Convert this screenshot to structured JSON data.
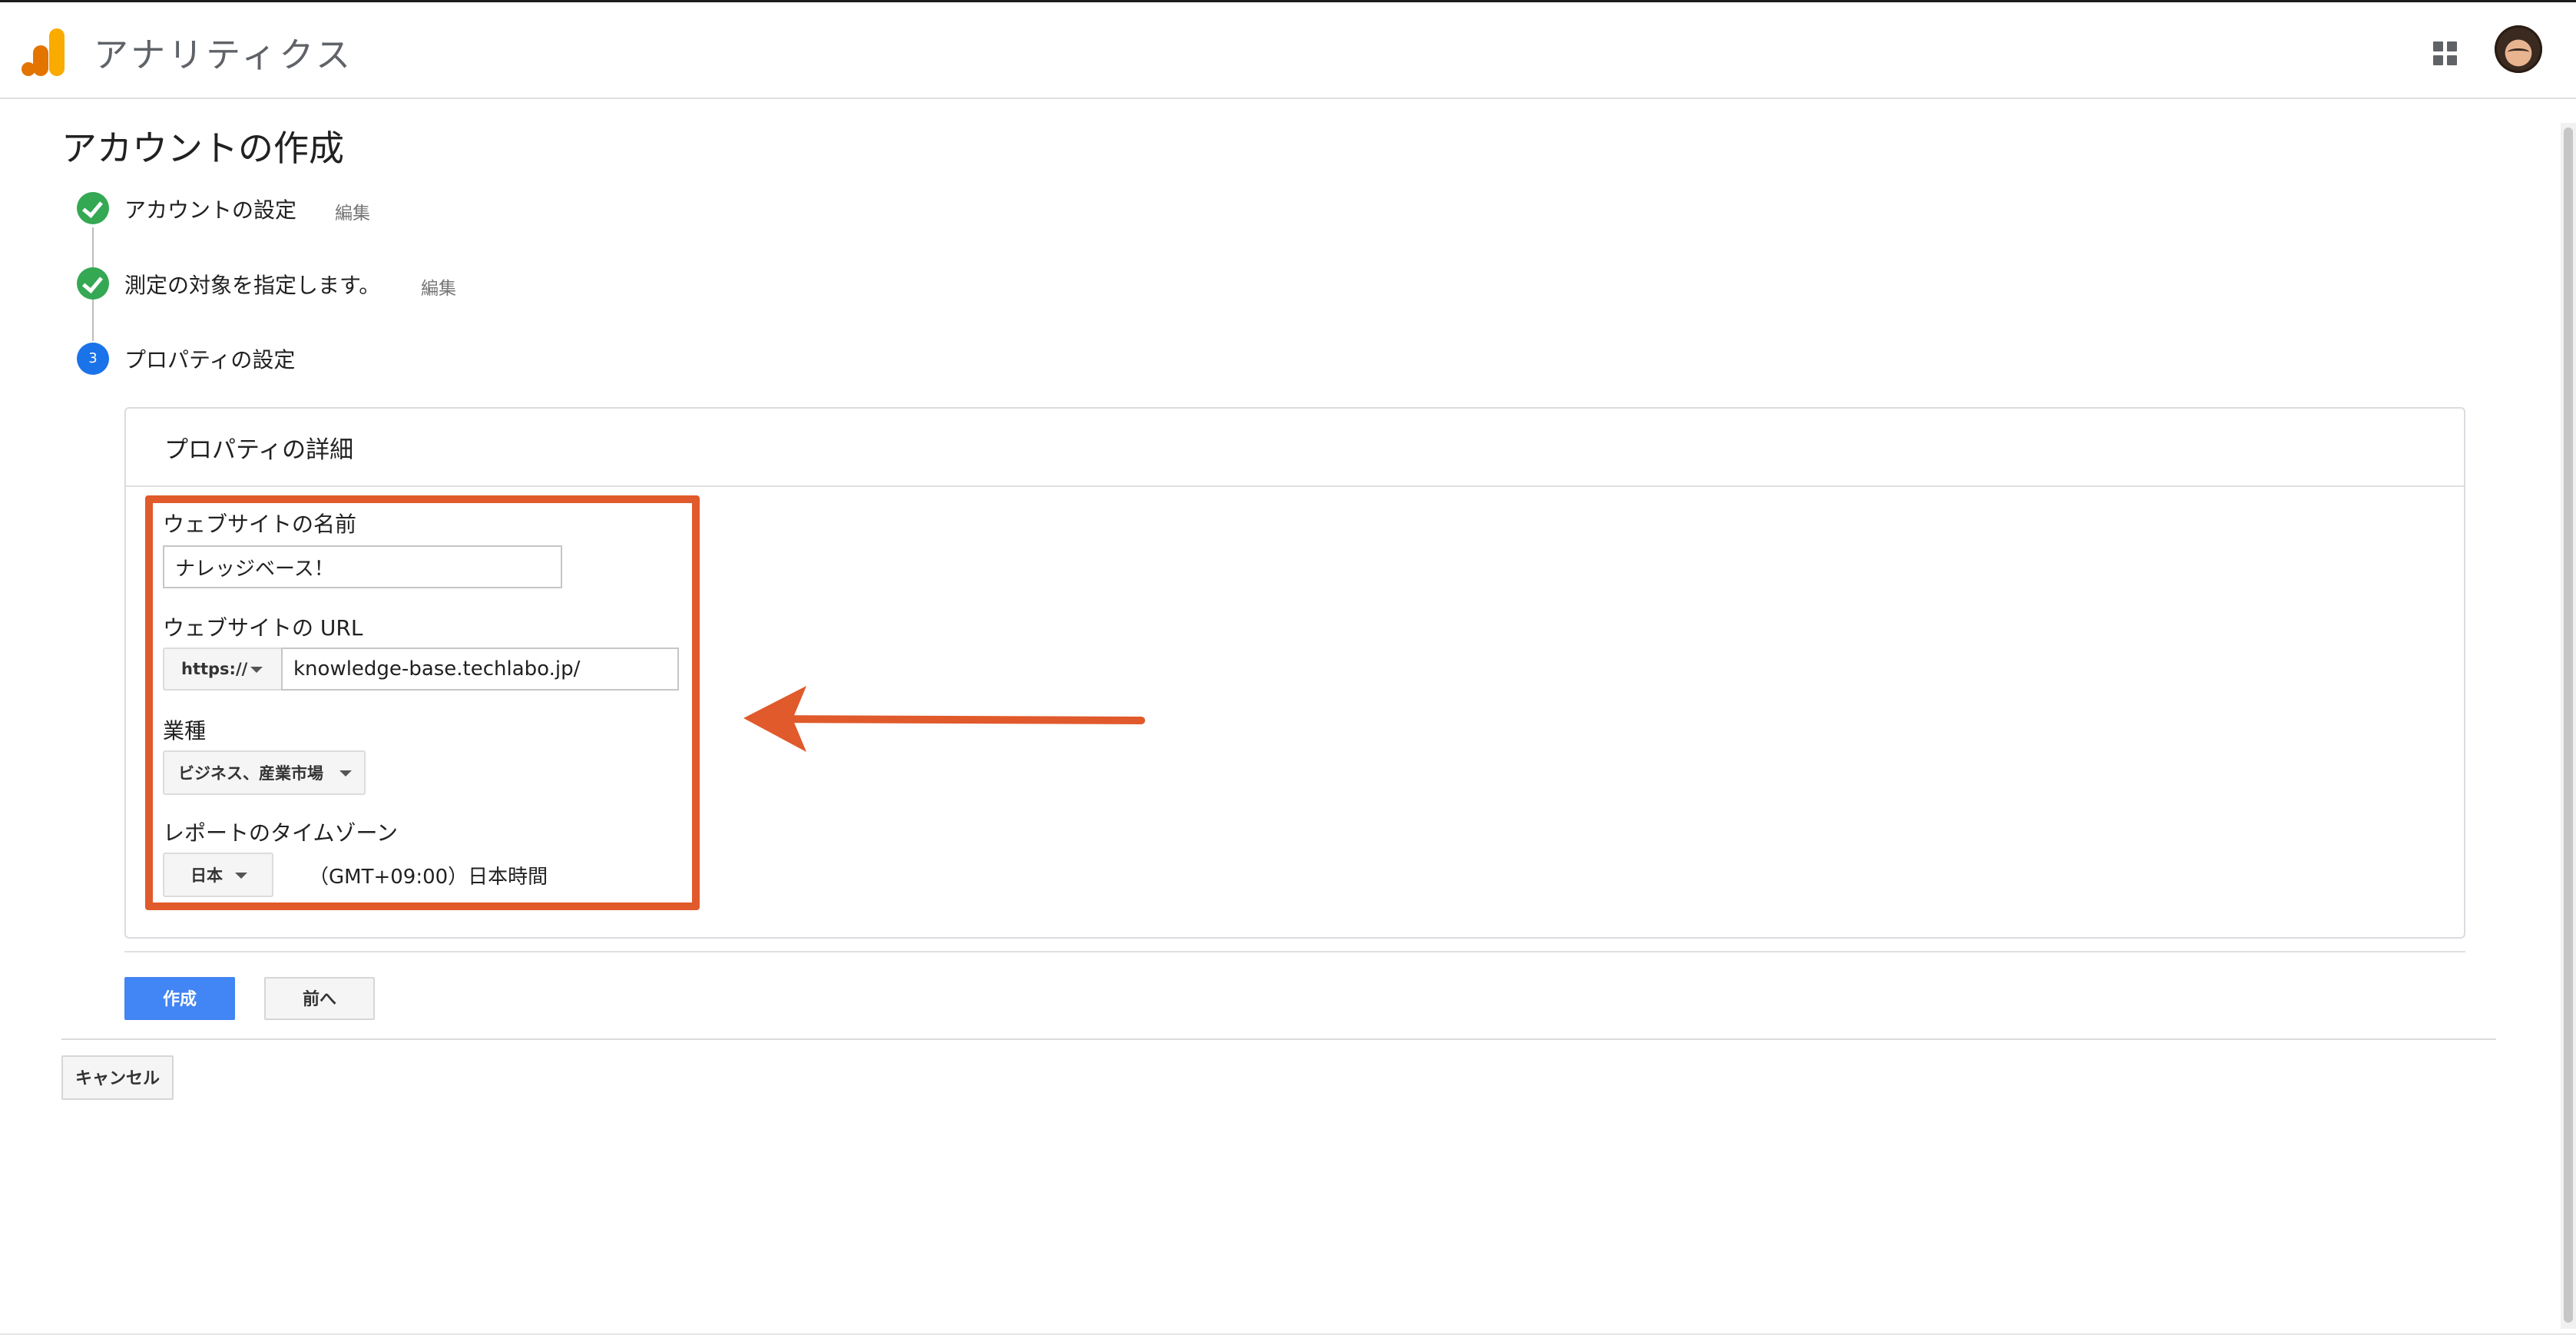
{
  "header": {
    "app_title": "アナリティクス",
    "logo_icon": "google-analytics-logo",
    "apps_icon": "apps-grid-icon",
    "avatar_icon": "user-avatar"
  },
  "page": {
    "title": "アカウントの作成"
  },
  "steps": [
    {
      "label": "アカウントの設定",
      "status": "done",
      "edit": "編集"
    },
    {
      "label": "測定の対象を指定します。",
      "status": "done",
      "edit": "編集"
    },
    {
      "label": "プロパティの設定",
      "status": "current",
      "number": "3"
    }
  ],
  "property_details": {
    "title": "プロパティの詳細",
    "website_name": {
      "label": "ウェブサイトの名前",
      "value": "ナレッジベース！"
    },
    "website_url": {
      "label": "ウェブサイトの URL",
      "protocol": "https://",
      "value": "knowledge-base.techlabo.jp/"
    },
    "industry": {
      "label": "業種",
      "selected": "ビジネス、産業市場"
    },
    "timezone": {
      "label": "レポートのタイムゾーン",
      "country": "日本",
      "zone": "（GMT+09:00）日本時間"
    }
  },
  "actions": {
    "create": "作成",
    "back": "前へ",
    "cancel": "キャンセル"
  },
  "colors": {
    "primary_button": "#4285f4",
    "step_done": "#34a853",
    "step_current": "#1a73e8",
    "annotation": "#e05a2b"
  }
}
